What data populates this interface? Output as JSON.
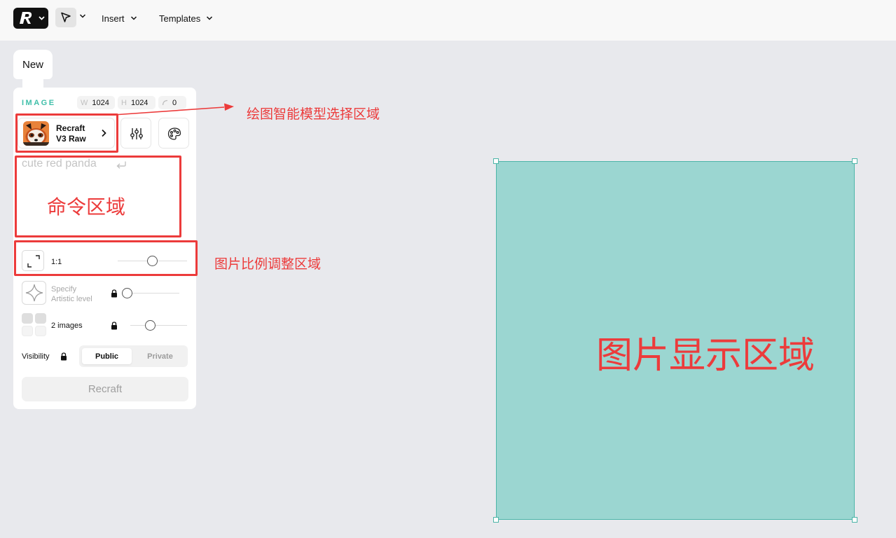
{
  "toolbar": {
    "insert_label": "Insert",
    "templates_label": "Templates"
  },
  "panel": {
    "new_tab_label": "New",
    "image_label": "IMAGE",
    "dims": {
      "w_key": "W",
      "w_value": "1024",
      "h_key": "H",
      "h_value": "1024",
      "seed_value": "0"
    },
    "model": {
      "line1": "Recraft",
      "line2": "V3 Raw"
    },
    "prompt_placeholder": "cute red panda",
    "ratio": {
      "label": "1:1",
      "slider_value": 0.5
    },
    "artistic": {
      "line1": "Specify",
      "line2": "Artistic level",
      "slider_value": 0
    },
    "images": {
      "label": "2 images",
      "slider_value": 0.35
    },
    "visibility": {
      "label": "Visibility",
      "public": "Public",
      "private": "Private",
      "selected": "Public"
    },
    "recraft_button": "Recraft"
  },
  "annotations": {
    "model_area": "绘图智能模型选择区域",
    "command_area": "命令区域",
    "ratio_area": "图片比例调整区域",
    "image_area": "图片显示区域"
  },
  "colors": {
    "accent": "#3fbfa9",
    "canvas_fill": "#9bd6d1",
    "canvas_border": "#4cb5a8",
    "annotation": "#ec3b3b",
    "background": "#e8e9ed"
  }
}
